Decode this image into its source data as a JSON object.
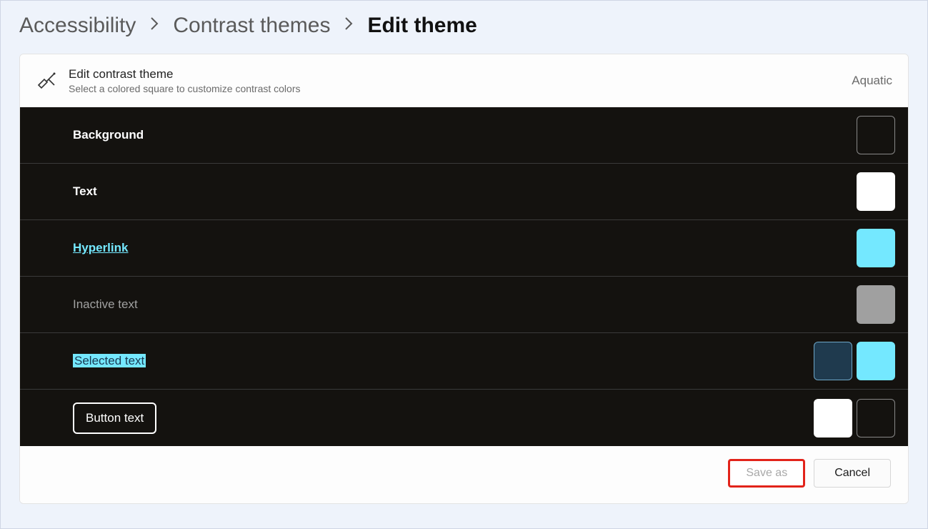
{
  "breadcrumb": {
    "accessibility": "Accessibility",
    "contrast_themes": "Contrast themes",
    "edit_theme": "Edit theme"
  },
  "header": {
    "title": "Edit contrast theme",
    "subtitle": "Select a colored square to customize contrast colors",
    "theme_name": "Aquatic"
  },
  "rows": {
    "background": {
      "label": "Background",
      "swatches": [
        "#14120f"
      ]
    },
    "text": {
      "label": "Text",
      "swatches": [
        "#ffffff"
      ]
    },
    "hyperlink": {
      "label": "Hyperlink",
      "swatches": [
        "#74e8ff"
      ]
    },
    "inactive": {
      "label": "Inactive text",
      "swatches": [
        "#a0a0a0"
      ]
    },
    "selected": {
      "label": "Selected text",
      "swatches": [
        "#1f3a4e",
        "#74e8ff"
      ]
    },
    "button": {
      "label": "Button text",
      "swatches": [
        "#ffffff",
        "#14120f"
      ]
    }
  },
  "footer": {
    "save_as": "Save as",
    "cancel": "Cancel"
  }
}
